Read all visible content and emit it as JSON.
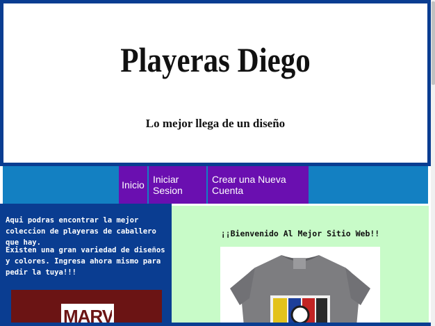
{
  "header": {
    "title": "Playeras Diego",
    "tagline": "Lo mejor llega de un diseño"
  },
  "nav": {
    "items": [
      "Inicio",
      "Iniciar Sesion",
      "Crear una Nueva Cuenta"
    ]
  },
  "left": {
    "paragraph1": "Aqui podras encontrar la mejor coleccion de playeras de caballero que hay.",
    "paragraph2": "Existen una gran variedad de diseños y colores. Ingresa ahora mismo para pedir la tuya!!!",
    "banner_logo": "MARVEL"
  },
  "right": {
    "welcome": "¡¡Bienvenido Al Mejor Sitio Web!!"
  },
  "colors": {
    "header_border": "#0a3d91",
    "nav_bar": "#1380c2",
    "nav_item": "#6a0fb0",
    "left_panel": "#0a3d91",
    "right_panel": "#c8fbc8",
    "marvel_red": "#6b1414"
  }
}
